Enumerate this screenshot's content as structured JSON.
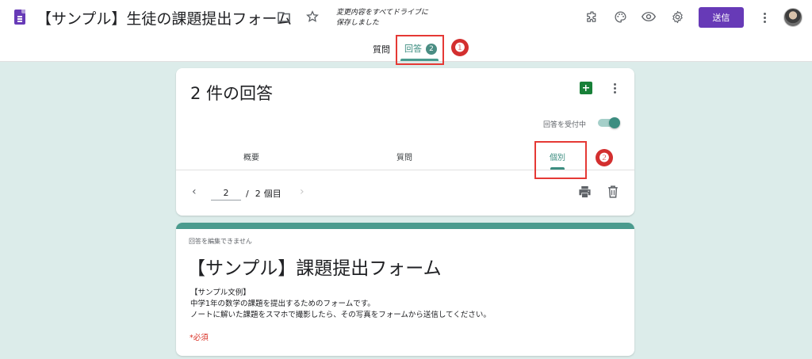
{
  "header": {
    "form_title": "【サンプル】生徒の課題提出フォーム",
    "save_status_line1": "変更内容をすべてドライブに",
    "save_status_line2": "保存しました",
    "send_label": "送信",
    "icons": [
      "folder-icon",
      "star-icon",
      "addon-icon",
      "palette-icon",
      "preview-eye-icon",
      "settings-gear-icon",
      "more-vert-icon"
    ]
  },
  "top_tabs": {
    "questions": "質問",
    "responses": "回答",
    "responses_count": "2"
  },
  "annotations": {
    "marker1": "❶",
    "marker2": "❷",
    "color": "#e53935"
  },
  "responses_card": {
    "title": "2 件の回答",
    "accepting_label": "回答を受付中",
    "accepting_on": true,
    "tabs": [
      "概要",
      "質問",
      "個別"
    ],
    "active_tab": "個別",
    "pager": {
      "current": "2",
      "separator": "/",
      "total": "2",
      "unit": "個目"
    }
  },
  "form_card": {
    "no_edit_notice": "回答を編集できません",
    "title": "【サンプル】課題提出フォーム",
    "description_lines": [
      "【サンプル文例】",
      "中学1年の数学の課題を提出するためのフォームです。",
      "ノートに解いた課題をスマホで撮影したら、その写真をフォームから送信してください。"
    ],
    "required_note": "*必須"
  },
  "colors": {
    "accent": "#673ab7",
    "theme": "#4a9b8e",
    "background": "#dcecea"
  }
}
